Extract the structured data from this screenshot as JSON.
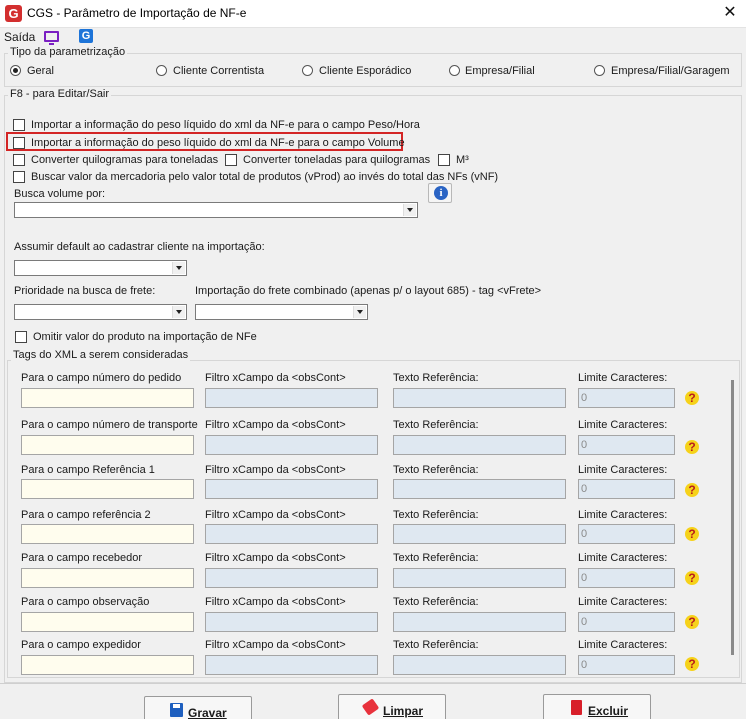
{
  "window": {
    "title": "CGS - Parâmetro de Importação de NF-e",
    "app_icon": "G",
    "close_label": "✕"
  },
  "menu": {
    "saida": "Saída",
    "g_icon_letter": "G"
  },
  "tipo": {
    "legend": "Tipo da parametrização",
    "options": [
      {
        "label": "Geral",
        "selected": true
      },
      {
        "label": "Cliente Correntista",
        "selected": false
      },
      {
        "label": "Cliente Esporádico",
        "selected": false
      },
      {
        "label": "Empresa/Filial",
        "selected": false
      },
      {
        "label": "Empresa/Filial/Garagem",
        "selected": false
      }
    ]
  },
  "f8": {
    "legend": "F8 - para Editar/Sair",
    "check_peso_hora": "Importar a informação do peso líquido do xml da NF-e para o campo Peso/Hora",
    "check_volume": "Importar a informação do peso líquido do xml da NF-e para o campo Volume",
    "check_kg_ton": "Converter quilogramas para toneladas",
    "check_ton_kg": "Converter toneladas para quilogramas",
    "check_m3": "M³",
    "check_vprod": "Buscar valor da mercadoria pelo valor total de produtos (vProd) ao invés do total das NFs (vNF)",
    "busca_volume_label": "Busca volume por:",
    "assumir_label": "Assumir default ao cadastrar cliente na importação:",
    "prioridade_label": "Prioridade na busca de frete:",
    "frete_combinado_label": "Importação do frete combinado (apenas p/ o layout 685) - tag <vFrete>",
    "check_omitir": "Omitir valor do produto na importação de NFe",
    "info_icon": "i"
  },
  "tags": {
    "legend": "Tags do XML a serem consideradas",
    "filtro_label": "Filtro xCampo da <obsCont>",
    "texto_label": "Texto Referência:",
    "limite_label": "Limite Caracteres:",
    "help_glyph": "?",
    "rows": [
      {
        "label": "Para o campo número do pedido",
        "limit": "0"
      },
      {
        "label": "Para o campo número de transporte",
        "limit": "0"
      },
      {
        "label": "Para o campo Referência 1",
        "limit": "0"
      },
      {
        "label": "Para o campo referência 2",
        "limit": "0"
      },
      {
        "label": "Para o campo recebedor",
        "limit": "0"
      },
      {
        "label": "Para o campo observação",
        "limit": "0"
      },
      {
        "label": "Para o campo expedidor",
        "limit": "0"
      }
    ]
  },
  "buttons": {
    "gravar": "Gravar",
    "limpar": "Limpar",
    "excluir": "Excluir"
  },
  "colors": {
    "highlight": "#d32525",
    "brand_red": "#d32f2f",
    "field_blue": "#dfe8f1",
    "field_yellow": "#fffdee"
  },
  "icons": [
    "app-logo-icon",
    "monitor-icon",
    "g-icon",
    "info-icon",
    "help-icon",
    "save-icon",
    "eraser-icon",
    "trash-icon",
    "close-icon"
  ]
}
